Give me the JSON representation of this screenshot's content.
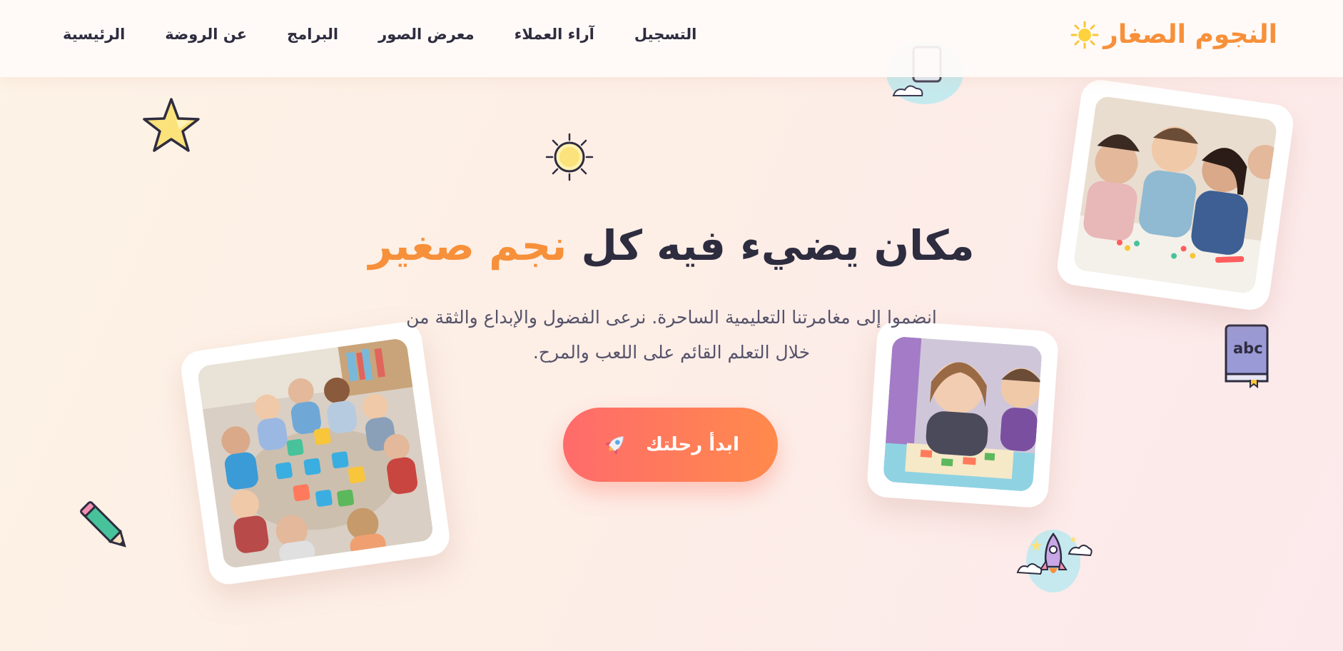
{
  "brand": {
    "name": "النجوم الصغار",
    "icon": "sun-icon",
    "color": "#f7903a"
  },
  "nav": {
    "items": [
      {
        "label": "الرئيسية"
      },
      {
        "label": "عن الروضة"
      },
      {
        "label": "البرامج"
      },
      {
        "label": "معرض الصور"
      },
      {
        "label": "آراء العملاء"
      },
      {
        "label": "التسجيل"
      }
    ]
  },
  "hero": {
    "title_main": "مكان يضيء فيه كل",
    "title_accent": "نجم صغير",
    "subtitle_line1": "انضموا إلى مغامرتنا التعليمية الساحرة. نرعى الفضول والإبداع والثقة من",
    "subtitle_line2": "خلال التعلم القائم على اللعب والمرح.",
    "cta_label": "ابدأ رحلتك",
    "cta_icon": "rocket-icon"
  },
  "doodles": {
    "book_text": "abc"
  },
  "colors": {
    "accent": "#f7903a",
    "text": "#2e2c3f",
    "cta_start": "#ff6b6b",
    "cta_end": "#ff8a4c"
  }
}
